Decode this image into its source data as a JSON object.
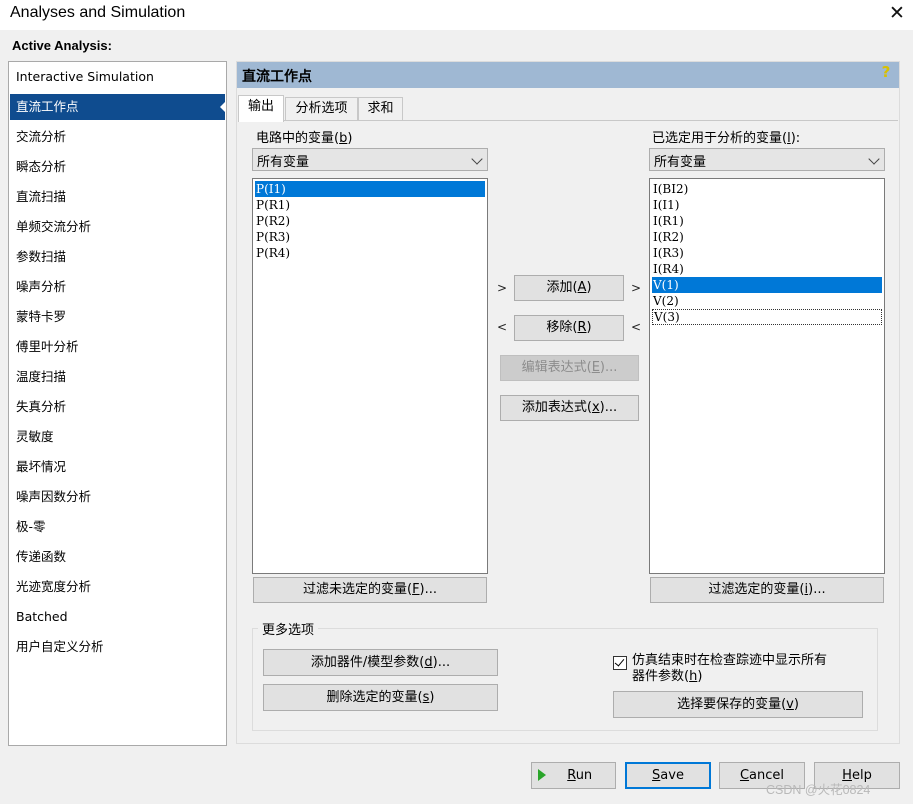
{
  "window": {
    "title": "Analyses and Simulation",
    "close_glyph": "✕"
  },
  "active_label": "Active Analysis:",
  "analyses": [
    "Interactive Simulation",
    "直流工作点",
    "交流分析",
    "瞬态分析",
    "直流扫描",
    "单频交流分析",
    "参数扫描",
    "噪声分析",
    "蒙特卡罗",
    "傅里叶分析",
    "温度扫描",
    "失真分析",
    "灵敏度",
    "最坏情况",
    "噪声因数分析",
    "极-零",
    "传递函数",
    "光迹宽度分析",
    "Batched",
    "用户自定义分析"
  ],
  "selected_analysis": "直流工作点",
  "panel": {
    "title": "直流工作点",
    "help_glyph": "?"
  },
  "tabs": [
    "输出",
    "分析选项",
    "求和"
  ],
  "left_section": {
    "label_text": "电路中的变量",
    "label_key": "b",
    "filter_value": "所有变量",
    "items": [
      "P(I1)",
      "P(R1)",
      "P(R2)",
      "P(R3)",
      "P(R4)"
    ],
    "selected_item": "P(I1)",
    "filter_button_text": "过滤未选定的变量",
    "filter_button_key": "F",
    "filter_button_suffix": "..."
  },
  "right_section": {
    "label_text": "已选定用于分析的变量",
    "label_key": "l",
    "label_suffix": ":",
    "filter_value": "所有变量",
    "items": [
      "I(BI2)",
      "I(I1)",
      "I(R1)",
      "I(R2)",
      "I(R3)",
      "I(R4)",
      "V(1)",
      "V(2)",
      "V(3)"
    ],
    "selected_item": "V(1)",
    "focused_item": "V(3)",
    "filter_button_text": "过滤选定的变量",
    "filter_button_key": "i",
    "filter_button_suffix": "..."
  },
  "middle_buttons": {
    "add": {
      "text": "添加",
      "key": "A"
    },
    "remove": {
      "text": "移除",
      "key": "R"
    },
    "edit_expr": {
      "text": "编辑表达式",
      "key": "E",
      "suffix": "..."
    },
    "add_expr": {
      "text": "添加表达式",
      "key": "x",
      "suffix": "..."
    },
    "gt": ">",
    "lt": "<"
  },
  "more_options": {
    "label": "更多选项",
    "add_device_param": {
      "text": "添加器件/模型参数",
      "key": "d",
      "suffix": "..."
    },
    "delete_selected": {
      "text": "删除选定的变量",
      "key": "s"
    },
    "checkbox_line1": "仿真结束时在检查踪迹中显示所有",
    "checkbox_line2": "器件参数",
    "checkbox_key": "h",
    "checkbox_checked": true,
    "select_save": {
      "text": "选择要保存的变量",
      "key": "v"
    }
  },
  "footer": {
    "run": {
      "text": "un",
      "key": "R"
    },
    "save": {
      "text": "ave",
      "key": "S"
    },
    "cancel": {
      "text": "ancel",
      "key": "C"
    },
    "help": {
      "text": "elp",
      "key": "H"
    }
  },
  "watermark": "CSDN @火花0824",
  "colors": {
    "selection": "#0078d7",
    "list_selection": "#0f4c8f",
    "header": "#9fb8d3",
    "run_icon": "#2aa52a"
  }
}
